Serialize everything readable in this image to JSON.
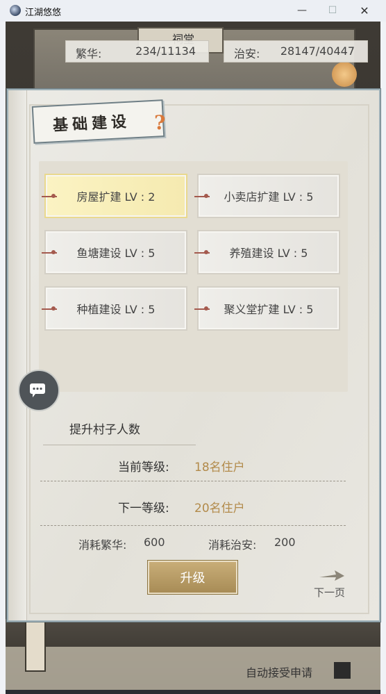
{
  "window": {
    "title": "江湖悠悠",
    "minimize": "—",
    "maximize": "☐",
    "close": "✕"
  },
  "background": {
    "sign_text": "祠堂"
  },
  "stats": {
    "prosperity_label": "繁华:",
    "prosperity_value": "234/11134",
    "security_label": "治安:",
    "security_value": "28147/40447"
  },
  "panel": {
    "title": "基础建设",
    "help_icon": "?",
    "items": [
      {
        "label": "房屋扩建 LV : 2",
        "active": true
      },
      {
        "label": "小卖店扩建 LV : 5",
        "active": false
      },
      {
        "label": "鱼塘建设 LV : 5",
        "active": false
      },
      {
        "label": "养殖建设 LV : 5",
        "active": false
      },
      {
        "label": "种植建设 LV : 5",
        "active": false
      },
      {
        "label": "聚义堂扩建 LV : 5",
        "active": false
      }
    ],
    "description": "提升村子人数",
    "current_level_label": "当前等级:",
    "current_level_value": "18名住户",
    "next_level_label": "下一等级:",
    "next_level_value": "20名住户",
    "cost_prosperity_label": "消耗繁华:",
    "cost_prosperity_value": "600",
    "cost_security_label": "消耗治安:",
    "cost_security_value": "200",
    "upgrade_button": "升级",
    "next_page": "下一页"
  },
  "footer": {
    "auto_accept_label": "自动接受申请"
  },
  "icons": {
    "chat": "chat-icon",
    "help": "question-icon",
    "arrow": "arrow-right-icon"
  }
}
